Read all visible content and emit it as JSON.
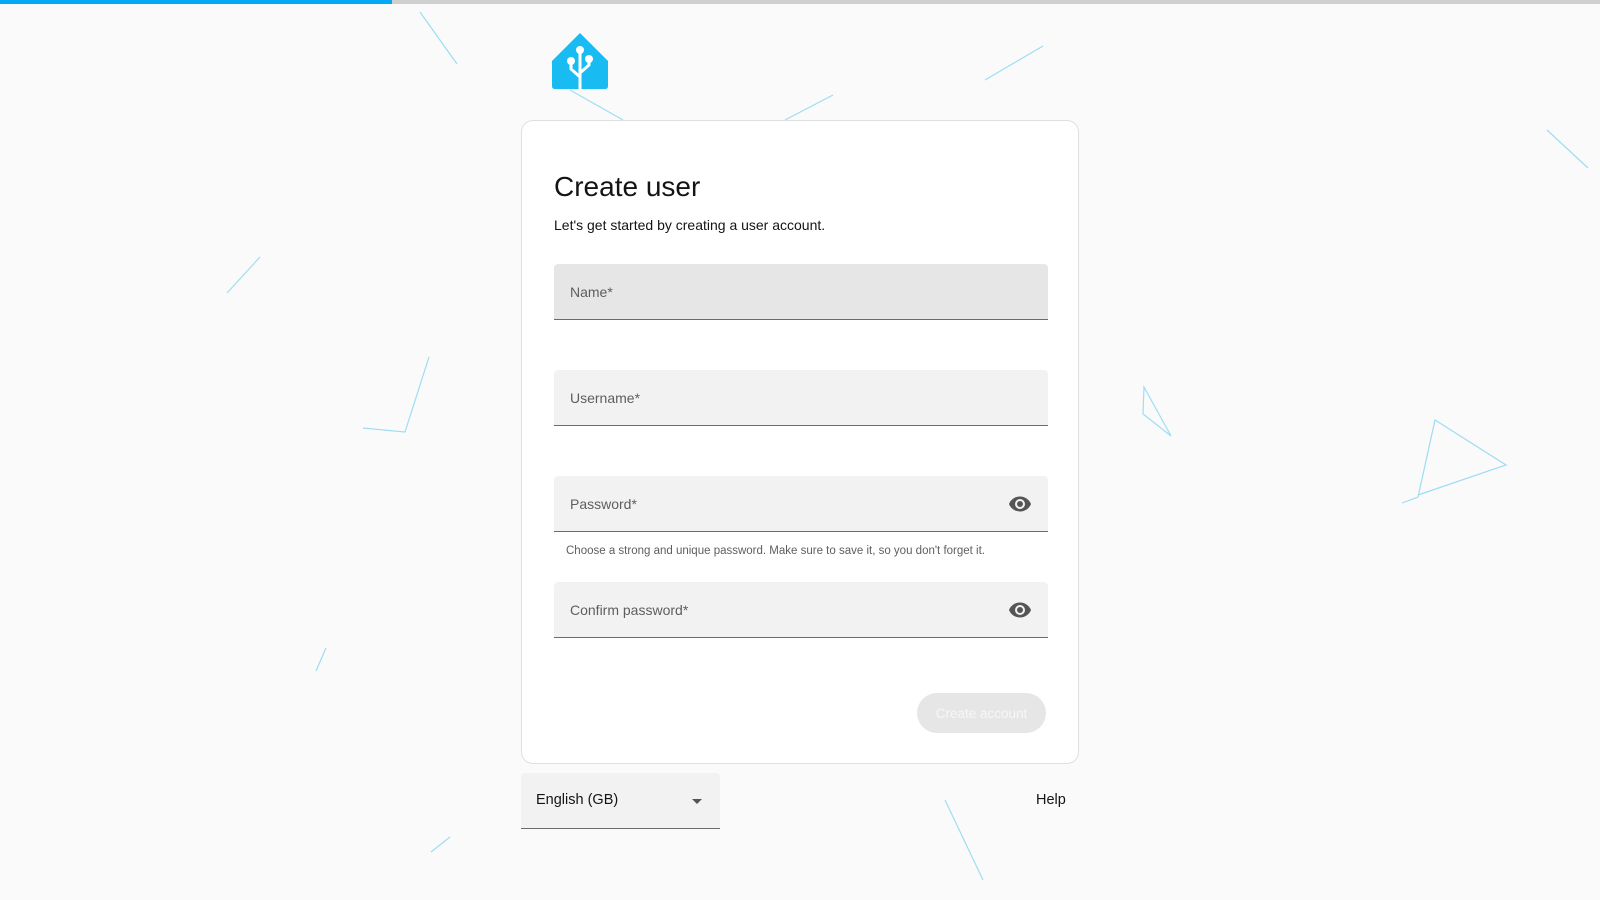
{
  "progress": {
    "fraction": 0.245,
    "color": "#03a9f4"
  },
  "brand": {
    "logo_icon": "home-assistant-logo-icon",
    "color": "#18bcf2"
  },
  "card": {
    "title": "Create user",
    "subtitle": "Let's get started by creating a user account."
  },
  "form": {
    "name": {
      "label": "Name*",
      "value": ""
    },
    "username": {
      "label": "Username*",
      "value": ""
    },
    "password": {
      "label": "Password*",
      "value": "",
      "helper": "Choose a strong and unique password. Make sure to save it, so you don't forget it.",
      "toggle_icon": "eye-icon"
    },
    "confirm_password": {
      "label": "Confirm password*",
      "value": "",
      "toggle_icon": "eye-icon"
    },
    "submit_label": "Create account"
  },
  "footer": {
    "language": {
      "selected": "English (GB)",
      "icon": "caret-down-icon"
    },
    "help_label": "Help"
  }
}
